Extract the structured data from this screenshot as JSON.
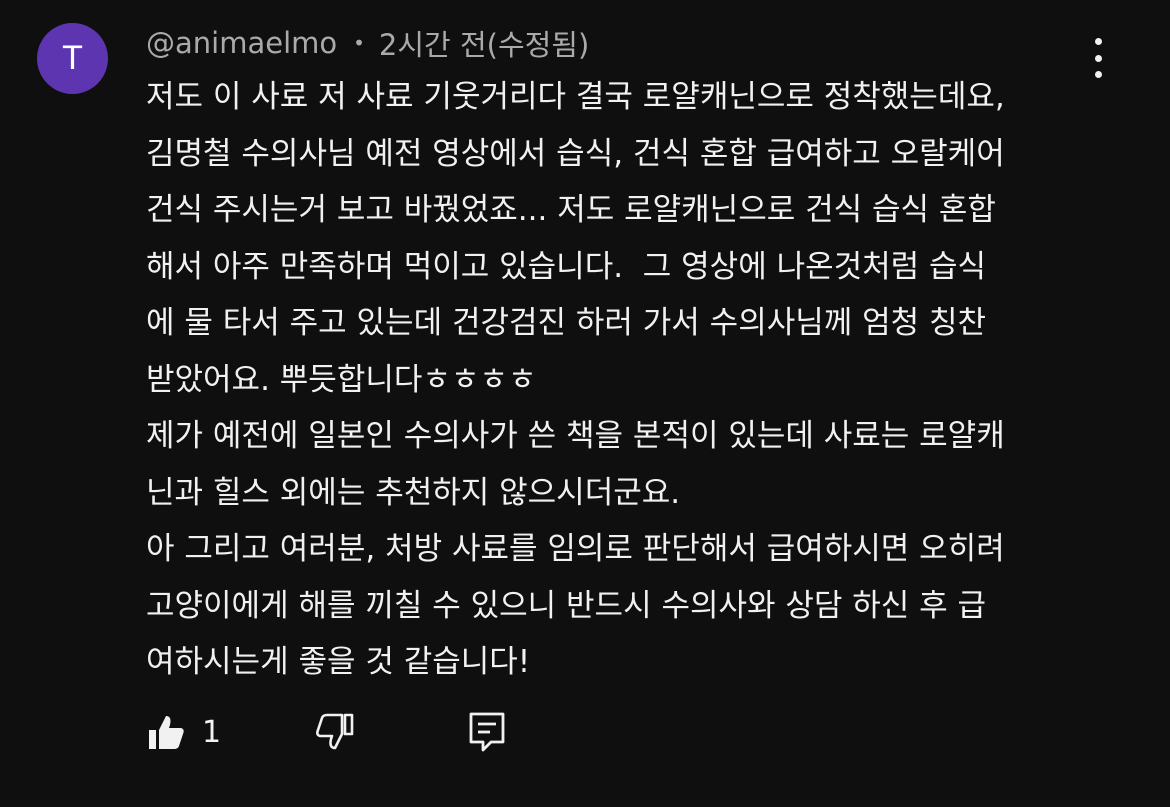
{
  "author": {
    "avatar_letter": "T",
    "avatar_color": "#5e35b1",
    "handle": "@animaelmo",
    "separator": "•",
    "timestamp": "2시간 전(수정됨)"
  },
  "comment_lines": [
    "저도 이 사료 저 사료 기웃거리다 결국 로얄캐닌으로 정착했는데요,",
    "김명철 수의사님 예전 영상에서 습식, 건식 혼합 급여하고 오랄케어",
    "건식 주시는거 보고 바꿨었죠... 저도 로얄캐닌으로 건식 습식 혼합",
    "해서 아주 만족하며 먹이고 있습니다.  그 영상에 나온것처럼 습식",
    "에 물 타서 주고 있는데 건강검진 하러 가서 수의사님께 엄청 칭찬",
    "받았어요. 뿌듯합니다ㅎㅎㅎㅎ",
    "제가 예전에 일본인 수의사가 쓴 책을 본적이 있는데 사료는 로얄캐",
    "닌과 힐스 외에는 추천하지 않으시더군요.",
    "아 그리고 여러분, 처방 사료를 임의로 판단해서 급여하시면 오히려",
    "고양이에게 해를 끼칠 수 있으니 반드시 수의사와 상담 하신 후 급",
    "여하시는게 좋을 것 같습니다!"
  ],
  "actions": {
    "like_icon": "thumb-up-filled-icon",
    "like_count": "1",
    "dislike_icon": "thumb-down-outline-icon",
    "reply_icon": "comment-reply-icon"
  },
  "menu_icon": "more-vert-icon",
  "colors": {
    "background": "#0f0f0f",
    "text": "#f1f1f1",
    "secondary_text": "#aaaaaa"
  }
}
